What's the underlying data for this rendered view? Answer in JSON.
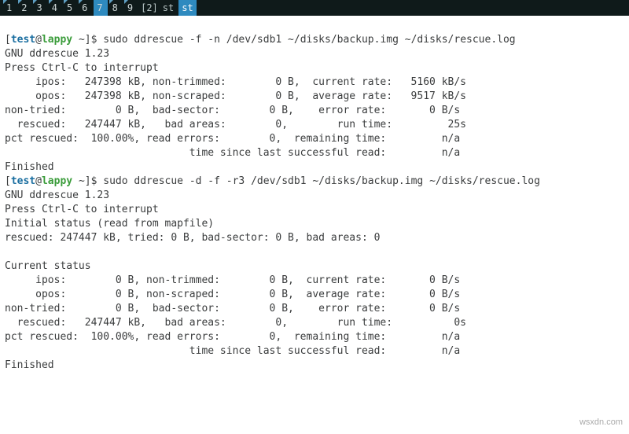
{
  "tabs": {
    "items": [
      {
        "n": "1",
        "l": ""
      },
      {
        "n": "2",
        "l": ""
      },
      {
        "n": "3",
        "l": ""
      },
      {
        "n": "4",
        "l": ""
      },
      {
        "n": "5",
        "l": ""
      },
      {
        "n": "6",
        "l": ""
      },
      {
        "n": "7",
        "l": ""
      },
      {
        "n": "8",
        "l": ""
      },
      {
        "n": "9",
        "l": ""
      }
    ],
    "group": "[2]",
    "st1": "st",
    "st2": "st"
  },
  "p1": {
    "user": "test",
    "host": "lappy",
    "path": "~",
    "cmd": "sudo ddrescue -f -n /dev/sdb1 ~/disks/backup.img ~/disks/rescue.log"
  },
  "r1": {
    "banner": "GNU ddrescue 1.23",
    "press": "Press Ctrl-C to interrupt",
    "l1": "     ipos:   247398 kB, non-trimmed:        0 B,  current rate:   5160 kB/s",
    "l2": "     opos:   247398 kB, non-scraped:        0 B,  average rate:   9517 kB/s",
    "l3": "non-tried:        0 B,  bad-sector:        0 B,    error rate:       0 B/s",
    "l4": "  rescued:   247447 kB,   bad areas:        0,        run time:         25s",
    "l5": "pct rescued:  100.00%, read errors:        0,  remaining time:         n/a",
    "l6": "                              time since last successful read:         n/a",
    "fin": "Finished"
  },
  "p2": {
    "user": "test",
    "host": "lappy",
    "path": "~",
    "cmd": "sudo ddrescue -d -f -r3 /dev/sdb1 ~/disks/backup.img ~/disks/rescue.log"
  },
  "r2": {
    "banner": "GNU ddrescue 1.23",
    "press": "Press Ctrl-C to interrupt",
    "init1": "Initial status (read from mapfile)",
    "init2": "rescued: 247447 kB, tried: 0 B, bad-sector: 0 B, bad areas: 0",
    "blank": "",
    "cur": "Current status",
    "l1": "     ipos:        0 B, non-trimmed:        0 B,  current rate:       0 B/s",
    "l2": "     opos:        0 B, non-scraped:        0 B,  average rate:       0 B/s",
    "l3": "non-tried:        0 B,  bad-sector:        0 B,    error rate:       0 B/s",
    "l4": "  rescued:   247447 kB,   bad areas:        0,        run time:          0s",
    "l5": "pct rescued:  100.00%, read errors:        0,  remaining time:         n/a",
    "l6": "                              time since last successful read:         n/a",
    "fin": "Finished"
  },
  "watermark": "wsxdn.com"
}
